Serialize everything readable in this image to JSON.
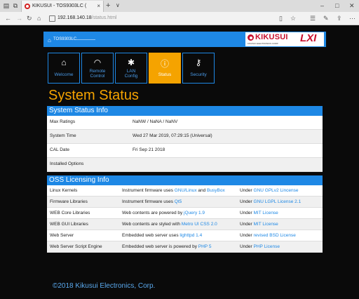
{
  "browser": {
    "tab_title": "KIKUSUI - TOS9303LC (",
    "tab_close": "×",
    "new_tab": "+",
    "tab_dropdown": "∨",
    "url_host": "192.168.140.18",
    "url_path": "/status.html",
    "win_min": "–",
    "win_max": "□",
    "win_close": "✕"
  },
  "header": {
    "device_name": "TOS9303LC",
    "logo_brand": "KIKUSUI",
    "logo_sub": "KIKUSUI ELECTRONICS CORP.",
    "logo_lxi": "LXI"
  },
  "nav": {
    "tiles": [
      {
        "label1": "Welcome",
        "label2": "",
        "icon": "home-icon"
      },
      {
        "label1": "Remote",
        "label2": "Control",
        "icon": "gauge-icon"
      },
      {
        "label1": "LAN",
        "label2": "Config",
        "icon": "gear-icon"
      },
      {
        "label1": "Status",
        "label2": "",
        "icon": "info-icon"
      },
      {
        "label1": "Security",
        "label2": "",
        "icon": "key-icon"
      }
    ]
  },
  "page_title": "System Status",
  "system_info": {
    "heading": "System Status Info",
    "rows": [
      {
        "label": "Max Ratings",
        "value": "NaNW / NaNA / NaNV"
      },
      {
        "label": "System Time",
        "value": "Wed 27 Mar 2019, 07:29:15 (Universal)"
      },
      {
        "label": "CAL Date",
        "value": "Fri Sep 21 2018"
      },
      {
        "label": "Installed Options",
        "value": ""
      }
    ]
  },
  "oss": {
    "heading": "OSS Licensing Info",
    "rows": [
      {
        "label": "Linux Kernels",
        "desc_pre": "Instrument firmware uses ",
        "desc_link": "GNU/Linux",
        "desc_post": " and ",
        "desc_link2": "BusyBox",
        "lic_pre": "Under ",
        "lic_link": "GNU GPLv2 Lincense"
      },
      {
        "label": "Firmware Libraries",
        "desc_pre": "Instrument firmware uses ",
        "desc_link": "Qt5",
        "desc_post": "",
        "desc_link2": "",
        "lic_pre": "Under ",
        "lic_link": "GNU LGPL License 2.1"
      },
      {
        "label": "WEB Core Libraries",
        "desc_pre": "Web contents are powered by ",
        "desc_link": "jQuery 1.9",
        "desc_post": "",
        "desc_link2": "",
        "lic_pre": "Under ",
        "lic_link": "MIT License"
      },
      {
        "label": "WEB GUI Libraries",
        "desc_pre": "Web contents are styled with ",
        "desc_link": "Metro UI CSS 2.0",
        "desc_post": "",
        "desc_link2": "",
        "lic_pre": "Under ",
        "lic_link": "MIT License"
      },
      {
        "label": "Web Server",
        "desc_pre": "Embedded web server uses ",
        "desc_link": "lighttpd 1.4",
        "desc_post": "",
        "desc_link2": "",
        "lic_pre": "Under ",
        "lic_link": "revised BSD License"
      },
      {
        "label": "Web Server Script Engine",
        "desc_pre": "Embedded web server is powered by ",
        "desc_link": "PHP 5",
        "desc_post": "",
        "desc_link2": "",
        "lic_pre": "Under ",
        "lic_link": "PHP License"
      }
    ]
  },
  "footer": "©2018 Kikusui Electronics, Corp.",
  "colors": {
    "accent": "#1e88e5",
    "active": "#f5a300",
    "brand": "#c8102e",
    "background": "#0a0a0a"
  }
}
